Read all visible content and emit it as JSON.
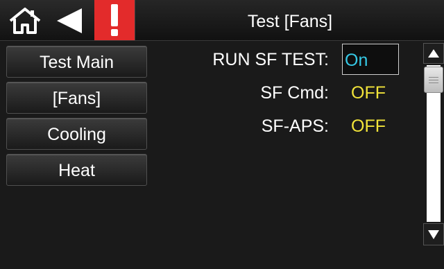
{
  "header": {
    "title": "Test [Fans]",
    "home_icon": "home-icon",
    "back_icon": "back-arrow-icon",
    "alarm_icon": "alarm-exclamation-icon",
    "alarm_color": "#e32b2b"
  },
  "sidebar": {
    "items": [
      {
        "label": "Test Main"
      },
      {
        "label": "[Fans]"
      },
      {
        "label": "Cooling"
      },
      {
        "label": "Heat"
      }
    ]
  },
  "main": {
    "run_sf_test": {
      "label": "RUN SF TEST:",
      "value": "On"
    },
    "sf_cmd": {
      "label": "SF Cmd:",
      "value": "OFF"
    },
    "sf_aps": {
      "label": "SF-APS:",
      "value": "OFF"
    }
  },
  "colors": {
    "value_text": "#f2e43a",
    "input_text": "#36c9e6",
    "background": "#1a1a1a"
  },
  "scrollbar": {
    "up_icon": "triangle-up-icon",
    "down_icon": "triangle-down-icon"
  }
}
